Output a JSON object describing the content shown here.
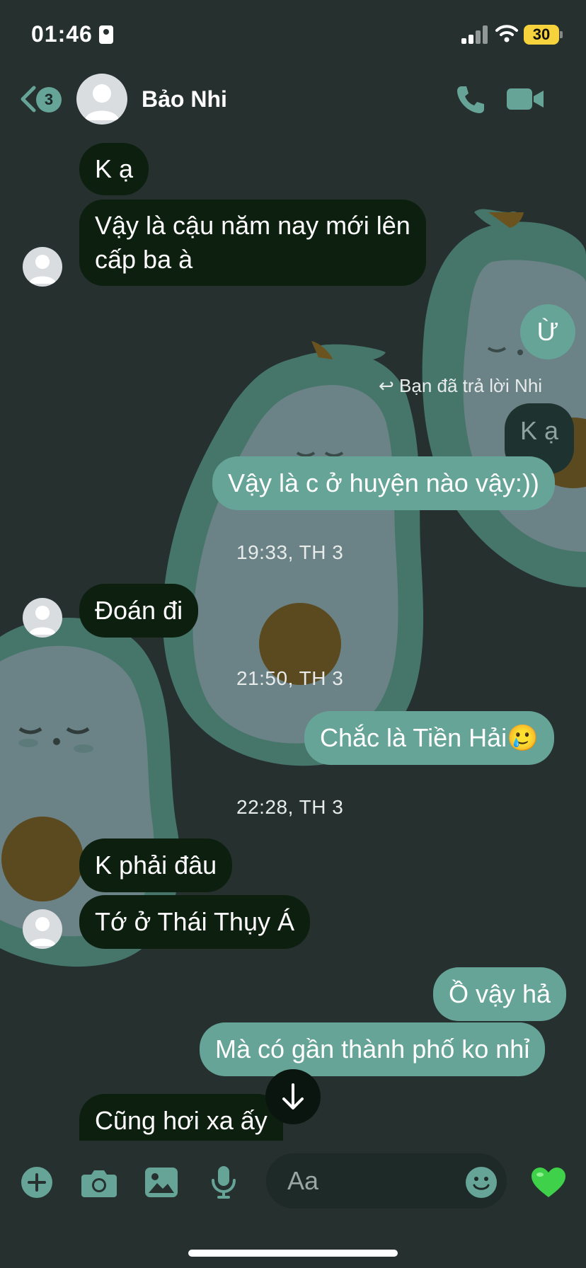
{
  "status_bar": {
    "time": "01:46",
    "battery": "30"
  },
  "header": {
    "back_count": "3",
    "contact_name": "Bảo Nhi"
  },
  "messages": {
    "m1": "K ạ",
    "m2_line1": "Vậy là cậu năm nay mới lên",
    "m2_line2": "cấp ba à",
    "m3": "Ừ",
    "reply_note": "Bạn đã trả lời Nhi",
    "quoted": "K ạ",
    "m4": "Vậy là c ở huyện nào vậy:))",
    "ts1": "19:33, TH 3",
    "m5": "Đoán đi",
    "ts2": "21:50, TH 3",
    "m6": "Chắc là Tiền Hải🥲",
    "ts3": "22:28, TH 3",
    "m7": "K phải đâu",
    "m8": "Tớ ở Thái Thụy Á",
    "m9": "Ồ vậy hả",
    "m10": "Mà có gần thành phố ko nhỉ",
    "m11": "Cũng hơi xa ấy"
  },
  "composer": {
    "placeholder": "Aa"
  },
  "icons": [
    "plus-icon",
    "camera-icon",
    "image-icon",
    "microphone-icon",
    "emoji-icon",
    "heart-icon",
    "phone-icon",
    "video-icon",
    "chevron-left-icon",
    "arrow-down-icon"
  ],
  "colors": {
    "background": "#25302f",
    "incoming_bubble": "#0d200f",
    "outgoing_bubble": "#66a497",
    "accent": "#66a497"
  }
}
